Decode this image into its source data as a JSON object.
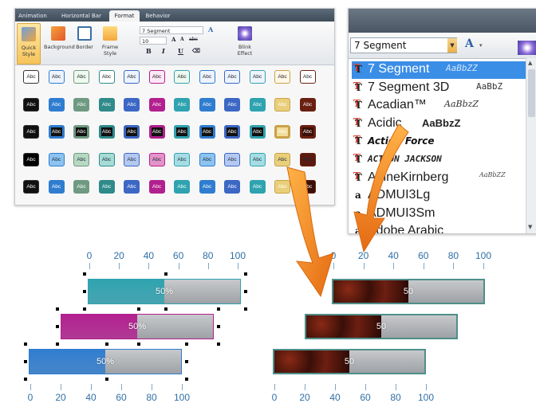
{
  "ribbon": {
    "tabs": [
      "Animation",
      "Horizontal Bar",
      "Format",
      "Behavior"
    ],
    "active_tab": "Format",
    "tools": {
      "quick_style": "Quick Style",
      "background": "Background",
      "border": "Border",
      "frame_style": "Frame Style",
      "blink_effect": "Blink Effect"
    },
    "font_box": "7 Segment",
    "size_box": "10",
    "format_buttons": [
      "B",
      "I",
      "U"
    ],
    "swatch_label": "Abc"
  },
  "font_dropdown": {
    "selected": "7 Segment",
    "fonts": [
      {
        "name": "7 Segment",
        "preview": "AaBbZZ"
      },
      {
        "name": "7 Segment 3D",
        "preview": "AaBbZ"
      },
      {
        "name": "Acadian™",
        "preview": "AaBbzZ"
      },
      {
        "name": "Acidic",
        "preview": "AaBbzZ"
      },
      {
        "name": "",
        "preview": "Action Force"
      },
      {
        "name": "",
        "preview": "ACTION JACKSON"
      },
      {
        "name": "AdineKirnberg",
        "preview": "AaBbZZ"
      },
      {
        "name": "ADMUI3Lg",
        "preview": ""
      },
      {
        "name": "ADMUI3Sm",
        "preview": ""
      },
      {
        "name": "Adobe Arabic",
        "preview": ""
      }
    ]
  },
  "scales": {
    "left_ticks": [
      "0",
      "20",
      "40",
      "60",
      "80",
      "100"
    ],
    "right_ticks": [
      "0",
      "20",
      "40",
      "60",
      "80",
      "100"
    ]
  },
  "bars_left": [
    {
      "label": "50%",
      "value": 50,
      "color": "#2fa3b0"
    },
    {
      "label": "50%",
      "value": 50,
      "color": "#b21f8e"
    },
    {
      "label": "50%",
      "value": 50,
      "color": "#2f7dd0"
    }
  ],
  "bars_right": [
    {
      "label": "50",
      "value": 50,
      "color": "#5a1a10"
    },
    {
      "label": "50",
      "value": 50,
      "color": "#5a1a10"
    },
    {
      "label": "50",
      "value": 50,
      "color": "#5a1a10"
    }
  ],
  "colors": {
    "arrow": "#f08a1c",
    "tick_text": "#2f6fa5",
    "highlight": "#3a8ee6"
  }
}
